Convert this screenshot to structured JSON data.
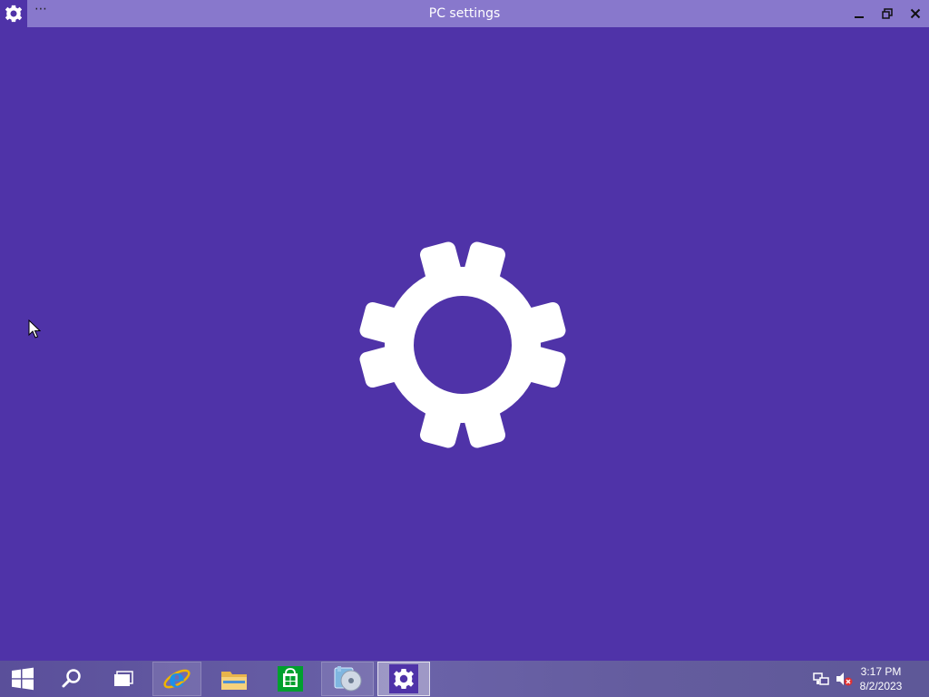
{
  "window": {
    "title": "PC settings",
    "menu_label": "⋯",
    "app_icon": "gear-icon",
    "controls": {
      "minimize": "minimize-icon",
      "restore": "restore-icon",
      "close": "close-icon"
    }
  },
  "splash": {
    "background": "#4f33a8",
    "icon": "gear-icon",
    "icon_color": "#ffffff"
  },
  "taskbar": {
    "items": [
      {
        "name": "start",
        "icon": "windows-logo-icon"
      },
      {
        "name": "search",
        "icon": "search-icon"
      },
      {
        "name": "task-view",
        "icon": "task-view-icon"
      },
      {
        "name": "internet-explorer",
        "icon": "internet-explorer-icon",
        "state": "pinned"
      },
      {
        "name": "file-explorer",
        "icon": "folder-icon"
      },
      {
        "name": "store",
        "icon": "store-icon"
      },
      {
        "name": "media-app",
        "icon": "media-disc-icon",
        "state": "pinned"
      },
      {
        "name": "pc-settings",
        "icon": "gear-icon",
        "state": "active"
      }
    ],
    "tray": {
      "network_icon": "network-icon",
      "volume_icon": "volume-muted-icon"
    },
    "clock": {
      "time": "3:17 PM",
      "date": "8/2/2023"
    }
  }
}
